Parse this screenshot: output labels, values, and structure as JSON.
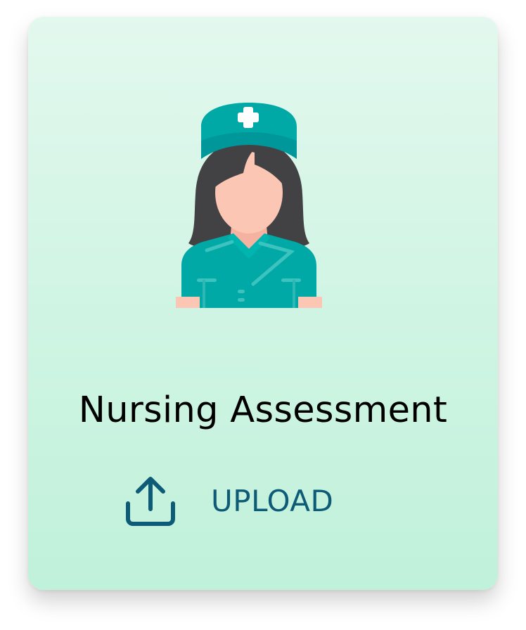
{
  "card": {
    "title": "Nursing Assessment",
    "illustration_icon": "nurse-avatar-icon",
    "upload": {
      "label": "UPLOAD",
      "icon": "upload-icon"
    }
  },
  "colors": {
    "card_gradient_top": "#e3f8ee",
    "card_gradient_bottom": "#c0f1da",
    "uniform": "#00a9a5",
    "hair": "#424244",
    "skin": "#fbc6b4",
    "upload_accent": "#0e5b78"
  }
}
